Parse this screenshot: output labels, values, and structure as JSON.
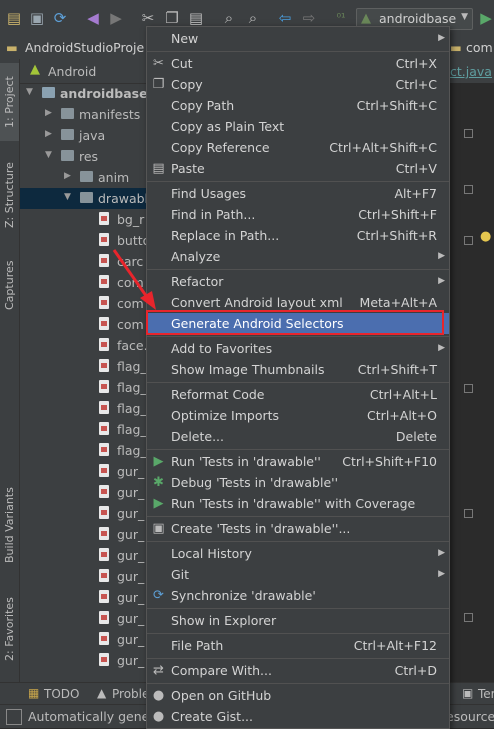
{
  "toolbar": {
    "icons": [
      "folder-icon",
      "save-icon",
      "sync-icon",
      "undo-icon",
      "redo-icon",
      "cut-icon",
      "copy-icon",
      "paste-icon",
      "find-icon",
      "replace-icon",
      "back-icon",
      "forward-icon",
      "build-icon"
    ],
    "project_selector": "androidbase"
  },
  "navbar": {
    "project": "AndroidStudioProje",
    "right_crumb": "com"
  },
  "editor": {
    "tab_label": "ct.java"
  },
  "left_strip": {
    "tabs": [
      "1: Project",
      "Z: Structure",
      "Captures",
      "Build Variants",
      "2: Favorites"
    ]
  },
  "panel": {
    "view": "Android",
    "tree": [
      {
        "label": "androidbase",
        "depth": 0,
        "type": "module",
        "expanded": true
      },
      {
        "label": "manifests",
        "depth": 1,
        "type": "folder",
        "expanded": false
      },
      {
        "label": "java",
        "depth": 1,
        "type": "folder",
        "expanded": false
      },
      {
        "label": "res",
        "depth": 1,
        "type": "folder",
        "expanded": true
      },
      {
        "label": "anim",
        "depth": 2,
        "type": "folder",
        "expanded": false
      },
      {
        "label": "drawabl",
        "depth": 2,
        "type": "folder",
        "expanded": true,
        "selected": true
      },
      {
        "label": "bg_r",
        "depth": 3,
        "type": "file"
      },
      {
        "label": "butto",
        "depth": 3,
        "type": "file"
      },
      {
        "label": "carc",
        "depth": 3,
        "type": "file"
      },
      {
        "label": "com",
        "depth": 3,
        "type": "file"
      },
      {
        "label": "com",
        "depth": 3,
        "type": "file"
      },
      {
        "label": "com",
        "depth": 3,
        "type": "file"
      },
      {
        "label": "face.",
        "depth": 3,
        "type": "file"
      },
      {
        "label": "flag_",
        "depth": 3,
        "type": "file"
      },
      {
        "label": "flag_",
        "depth": 3,
        "type": "file"
      },
      {
        "label": "flag_",
        "depth": 3,
        "type": "file"
      },
      {
        "label": "flag_",
        "depth": 3,
        "type": "file"
      },
      {
        "label": "flag_",
        "depth": 3,
        "type": "file"
      },
      {
        "label": "gur_",
        "depth": 3,
        "type": "file"
      },
      {
        "label": "gur_",
        "depth": 3,
        "type": "file"
      },
      {
        "label": "gur_",
        "depth": 3,
        "type": "file"
      },
      {
        "label": "gur_",
        "depth": 3,
        "type": "file"
      },
      {
        "label": "gur_",
        "depth": 3,
        "type": "file"
      },
      {
        "label": "gur_",
        "depth": 3,
        "type": "file"
      },
      {
        "label": "gur_",
        "depth": 3,
        "type": "file"
      },
      {
        "label": "gur_",
        "depth": 3,
        "type": "file"
      },
      {
        "label": "gur_",
        "depth": 3,
        "type": "file"
      },
      {
        "label": "gur_",
        "depth": 3,
        "type": "file"
      }
    ]
  },
  "bottom_bar": {
    "todo": "TODO",
    "problems": "Proble",
    "terminal": "Ter"
  },
  "status_bar": {
    "text": "Automatically genera",
    "right": "esource"
  },
  "context_menu": {
    "items": [
      {
        "label": "New",
        "shortcut": "",
        "submenu": true,
        "icon": ""
      },
      {
        "sep": true
      },
      {
        "label": "Cut",
        "shortcut": "Ctrl+X",
        "icon": "✂"
      },
      {
        "label": "Copy",
        "shortcut": "Ctrl+C",
        "icon": "❐"
      },
      {
        "label": "Copy Path",
        "shortcut": "Ctrl+Shift+C",
        "icon": ""
      },
      {
        "label": "Copy as Plain Text",
        "shortcut": "",
        "icon": ""
      },
      {
        "label": "Copy Reference",
        "shortcut": "Ctrl+Alt+Shift+C",
        "icon": ""
      },
      {
        "label": "Paste",
        "shortcut": "Ctrl+V",
        "icon": "▤"
      },
      {
        "sep": true
      },
      {
        "label": "Find Usages",
        "shortcut": "Alt+F7",
        "icon": ""
      },
      {
        "label": "Find in Path...",
        "shortcut": "Ctrl+Shift+F",
        "icon": ""
      },
      {
        "label": "Replace in Path...",
        "shortcut": "Ctrl+Shift+R",
        "icon": ""
      },
      {
        "label": "Analyze",
        "shortcut": "",
        "submenu": true,
        "icon": ""
      },
      {
        "sep": true
      },
      {
        "label": "Refactor",
        "shortcut": "",
        "submenu": true,
        "icon": ""
      },
      {
        "label": "Convert Android layout xml",
        "shortcut": "Meta+Alt+A",
        "icon": ""
      },
      {
        "label": "Generate Android Selectors",
        "shortcut": "",
        "icon": "",
        "highlight": true
      },
      {
        "sep": true
      },
      {
        "label": "Add to Favorites",
        "shortcut": "",
        "submenu": true,
        "icon": ""
      },
      {
        "label": "Show Image Thumbnails",
        "shortcut": "Ctrl+Shift+T",
        "icon": ""
      },
      {
        "sep": true
      },
      {
        "label": "Reformat Code",
        "shortcut": "Ctrl+Alt+L",
        "icon": ""
      },
      {
        "label": "Optimize Imports",
        "shortcut": "Ctrl+Alt+O",
        "icon": ""
      },
      {
        "label": "Delete...",
        "shortcut": "Delete",
        "icon": ""
      },
      {
        "sep": true
      },
      {
        "label": "Run 'Tests in 'drawable''",
        "shortcut": "Ctrl+Shift+F10",
        "icon": "▶"
      },
      {
        "label": "Debug 'Tests in 'drawable''",
        "shortcut": "",
        "icon": "✱"
      },
      {
        "label": "Run 'Tests in 'drawable'' with Coverage",
        "shortcut": "",
        "icon": "▶"
      },
      {
        "sep": true
      },
      {
        "label": "Create 'Tests in 'drawable''...",
        "shortcut": "",
        "icon": "▣"
      },
      {
        "sep": true
      },
      {
        "label": "Local History",
        "shortcut": "",
        "submenu": true,
        "icon": ""
      },
      {
        "label": "Git",
        "shortcut": "",
        "submenu": true,
        "icon": ""
      },
      {
        "label": "Synchronize 'drawable'",
        "shortcut": "",
        "icon": "⟳"
      },
      {
        "sep": true
      },
      {
        "label": "Show in Explorer",
        "shortcut": "",
        "icon": ""
      },
      {
        "sep": true
      },
      {
        "label": "File Path",
        "shortcut": "Ctrl+Alt+F12",
        "icon": ""
      },
      {
        "sep": true
      },
      {
        "label": "Compare With...",
        "shortcut": "Ctrl+D",
        "icon": "⇄"
      },
      {
        "sep": true
      },
      {
        "label": "Open on GitHub",
        "shortcut": "",
        "icon": "●"
      },
      {
        "label": "Create Gist...",
        "shortcut": "",
        "icon": "●"
      }
    ]
  },
  "colors": {
    "highlight": "#4b6eaf",
    "annotation_red": "#e8252c",
    "run_green": "#59a869"
  }
}
